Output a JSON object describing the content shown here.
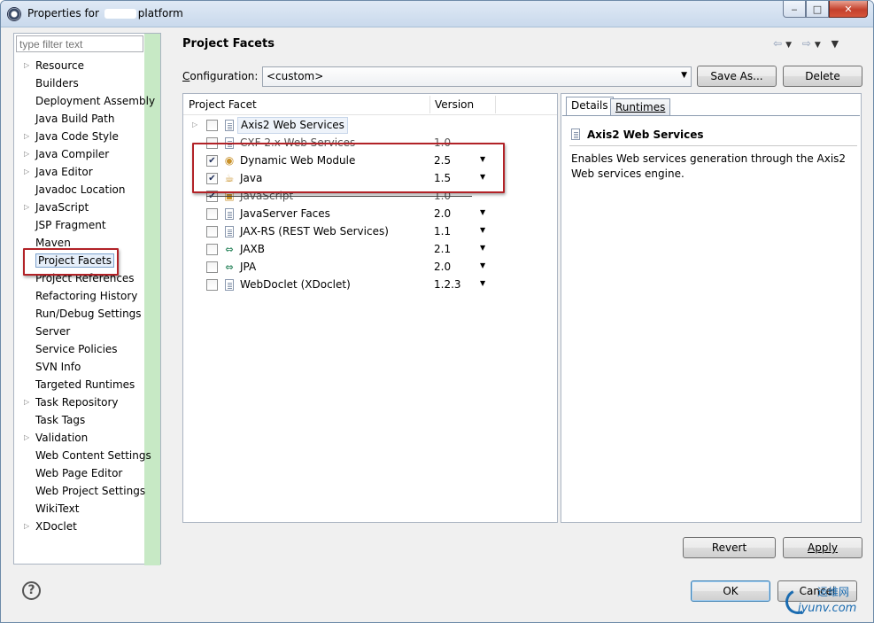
{
  "window": {
    "title_prefix": "Properties for",
    "title_suffix": "platform",
    "min_label": "‒",
    "max_label": "□",
    "close_label": "✕"
  },
  "filter": {
    "placeholder": "type filter text"
  },
  "tree": [
    {
      "label": "Resource",
      "expandable": true
    },
    {
      "label": "Builders",
      "expandable": false
    },
    {
      "label": "Deployment Assembly",
      "expandable": false
    },
    {
      "label": "Java Build Path",
      "expandable": false
    },
    {
      "label": "Java Code Style",
      "expandable": true
    },
    {
      "label": "Java Compiler",
      "expandable": true
    },
    {
      "label": "Java Editor",
      "expandable": true
    },
    {
      "label": "Javadoc Location",
      "expandable": false
    },
    {
      "label": "JavaScript",
      "expandable": true
    },
    {
      "label": "JSP Fragment",
      "expandable": false
    },
    {
      "label": "Maven",
      "expandable": false
    },
    {
      "label": "Project Facets",
      "expandable": false,
      "selected": true
    },
    {
      "label": "Project References",
      "expandable": false
    },
    {
      "label": "Refactoring History",
      "expandable": false
    },
    {
      "label": "Run/Debug Settings",
      "expandable": false
    },
    {
      "label": "Server",
      "expandable": false
    },
    {
      "label": "Service Policies",
      "expandable": false
    },
    {
      "label": "SVN Info",
      "expandable": false
    },
    {
      "label": "Targeted Runtimes",
      "expandable": false
    },
    {
      "label": "Task Repository",
      "expandable": true
    },
    {
      "label": "Task Tags",
      "expandable": false
    },
    {
      "label": "Validation",
      "expandable": true
    },
    {
      "label": "Web Content Settings",
      "expandable": false
    },
    {
      "label": "Web Page Editor",
      "expandable": false
    },
    {
      "label": "Web Project Settings",
      "expandable": false
    },
    {
      "label": "WikiText",
      "expandable": false
    },
    {
      "label": "XDoclet",
      "expandable": true
    }
  ],
  "page": {
    "title": "Project Facets"
  },
  "configuration": {
    "label_pre": "C",
    "label_rest": "onfiguration:",
    "value": "<custom>",
    "save_as_label": "Save As...",
    "delete_label": "Delete"
  },
  "facet_table": {
    "col_facet": "Project Facet",
    "col_version": "Version",
    "rows": [
      {
        "name": "Axis2 Web Services",
        "version": "",
        "checked": false,
        "icon": "page-icon",
        "expandable": true,
        "highlight": true,
        "dropdown": false
      },
      {
        "name": "CXF 2.x Web Services",
        "version": "1.0",
        "checked": false,
        "icon": "page-icon",
        "expandable": false,
        "strike": true,
        "dropdown": false
      },
      {
        "name": "Dynamic Web Module",
        "version": "2.5",
        "checked": true,
        "icon": "web-module-icon",
        "expandable": false,
        "dropdown": true
      },
      {
        "name": "Java",
        "version": "1.5",
        "checked": true,
        "icon": "java-icon",
        "expandable": false,
        "dropdown": true
      },
      {
        "name": "JavaScript",
        "version": "1.0",
        "checked": true,
        "icon": "javascript-icon",
        "expandable": false,
        "strike": true,
        "dropdown": false
      },
      {
        "name": "JavaServer Faces",
        "version": "2.0",
        "checked": false,
        "icon": "page-icon",
        "expandable": false,
        "dropdown": true
      },
      {
        "name": "JAX-RS (REST Web Services)",
        "version": "1.1",
        "checked": false,
        "icon": "page-icon",
        "expandable": false,
        "dropdown": true
      },
      {
        "name": "JAXB",
        "version": "2.1",
        "checked": false,
        "icon": "arrows-icon",
        "expandable": false,
        "dropdown": true
      },
      {
        "name": "JPA",
        "version": "2.0",
        "checked": false,
        "icon": "arrows-icon",
        "expandable": false,
        "dropdown": true
      },
      {
        "name": "WebDoclet (XDoclet)",
        "version": "1.2.3",
        "checked": false,
        "icon": "page-icon",
        "expandable": false,
        "dropdown": true
      }
    ]
  },
  "details": {
    "tab_details": "Details",
    "tab_runtimes": "Runtimes",
    "title": "Axis2 Web Services",
    "description": "Enables Web services generation through the Axis2 Web services engine."
  },
  "buttons": {
    "revert": "Revert",
    "apply": "Apply",
    "ok": "OK",
    "cancel": "Cancel",
    "help": "?"
  },
  "watermark": {
    "top": "运维网",
    "bottom": "iyunv.com"
  },
  "colors": {
    "highlight_box": "#b22227",
    "tree_green_bar": "#c7e9c5",
    "watermark": "#1a6bb0"
  }
}
